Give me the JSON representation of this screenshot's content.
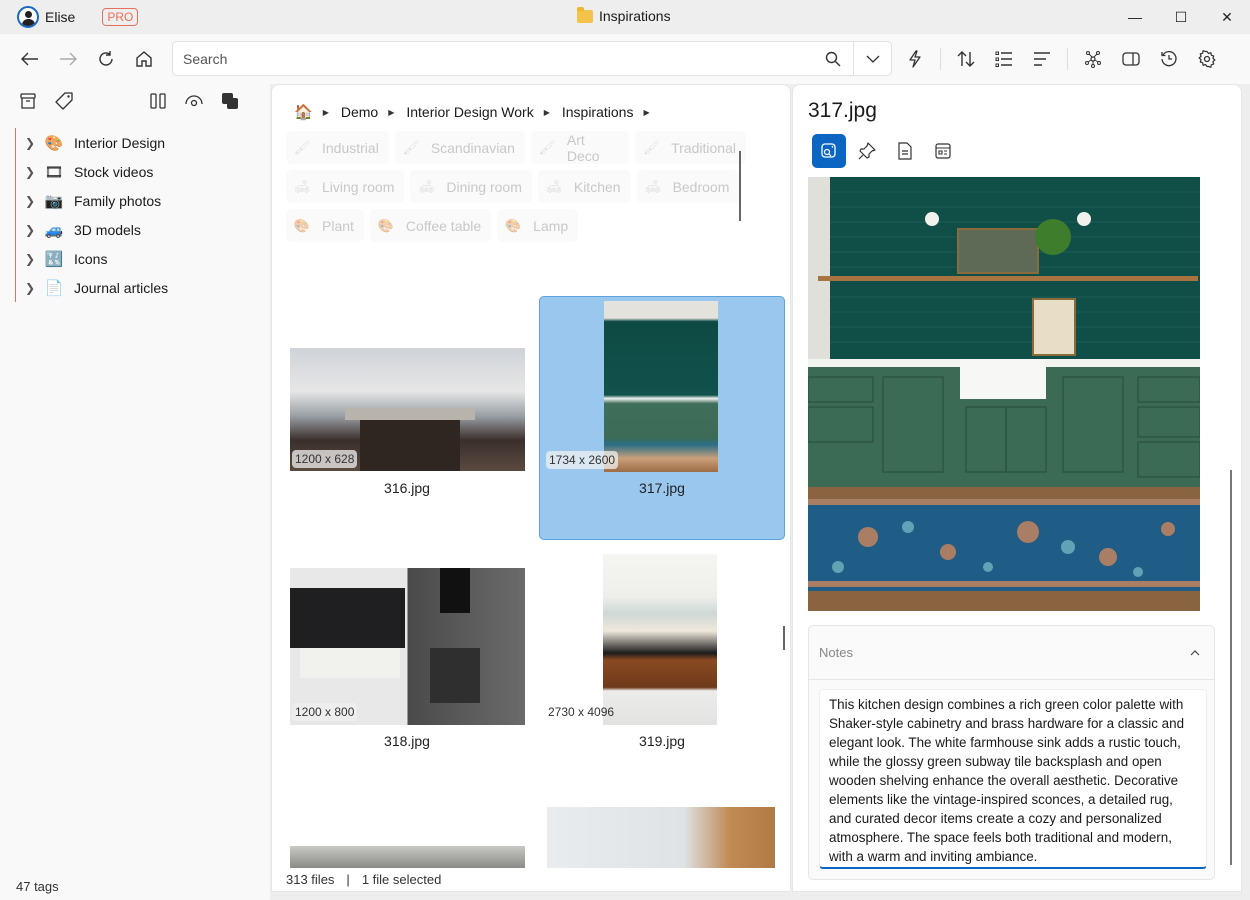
{
  "titlebar": {
    "user_name": "Elise",
    "badge": "PRO",
    "window_title": "Inspirations",
    "controls": {
      "minimize": "—",
      "maximize": "☐",
      "close": "✕"
    }
  },
  "toolbar": {
    "back": "←",
    "forward": "→",
    "reload": "↻",
    "home": "⌂",
    "search_placeholder": "Search",
    "search_value": "",
    "search_icon": "⚲",
    "dropdown_icon": "⌄",
    "quick_actions_icon": "ϟ",
    "sort_icon": "⇅",
    "list_icon": "☰",
    "align_icon": "≡",
    "graph_icon": "✲",
    "panel_icon": "▭",
    "history_icon": "◷",
    "settings_icon": "⚙"
  },
  "sidebar": {
    "top_icons": [
      "archive",
      "tag",
      "columns",
      "eye",
      "overlap"
    ],
    "items": [
      {
        "label": "Interior Design",
        "emoji": "🎨"
      },
      {
        "label": "Stock videos",
        "emoji": "🎞"
      },
      {
        "label": "Family photos",
        "emoji": "📷"
      },
      {
        "label": "3D models",
        "emoji": "🚙"
      },
      {
        "label": "Icons",
        "emoji": "🔣"
      },
      {
        "label": "Journal articles",
        "emoji": "📄"
      }
    ],
    "tags_count": "47 tags"
  },
  "main": {
    "breadcrumb": [
      {
        "label": "🏠"
      },
      {
        "label": "Demo"
      },
      {
        "label": "Interior Design Work"
      },
      {
        "label": "Inspirations"
      }
    ],
    "tag_rows": [
      [
        {
          "label": "Industrial",
          "icon": "🖌"
        },
        {
          "label": "Scandinavian",
          "icon": "🖌"
        },
        {
          "label": "Art Deco",
          "icon": "🖌"
        },
        {
          "label": "Traditional",
          "icon": "🖌"
        }
      ],
      [
        {
          "label": "Living room",
          "icon": "🛋"
        },
        {
          "label": "Dining room",
          "icon": "🛋"
        },
        {
          "label": "Kitchen",
          "icon": "🛋"
        },
        {
          "label": "Bedroom",
          "icon": "🛋"
        }
      ],
      [
        {
          "label": "Plant",
          "icon": "🎨"
        },
        {
          "label": "Coffee table",
          "icon": "🎨"
        },
        {
          "label": "Lamp",
          "icon": "🎨"
        }
      ]
    ],
    "files": [
      {
        "name": "316.jpg",
        "dims": "1200 x 628",
        "selected": false
      },
      {
        "name": "317.jpg",
        "dims": "1734 x 2600",
        "selected": true
      },
      {
        "name": "318.jpg",
        "dims": "1200 x 800",
        "selected": false
      },
      {
        "name": "319.jpg",
        "dims": "2730 x 4096",
        "selected": false
      }
    ],
    "status": {
      "files": "313 files",
      "sep": "|",
      "selected": "1 file selected"
    }
  },
  "inspector": {
    "title": "317.jpg",
    "tabs": [
      "image-search",
      "pin",
      "document",
      "form"
    ],
    "notes_label": "Notes",
    "notes_text": "This kitchen design combines a rich green color palette with Shaker-style cabinetry and brass hardware for a classic and elegant look. The white farmhouse sink adds a rustic touch, while the glossy green subway tile backsplash and open wooden shelving enhance the overall aesthetic. Decorative elements like the vintage-inspired sconces, a detailed rug, and curated decor items create a cozy and personalized atmosphere. The space feels both traditional and modern, with a warm and inviting ambiance."
  },
  "colors": {
    "accent": "#0a66c2",
    "selection": "#99c7ee",
    "pro_badge": "#e8705a"
  }
}
